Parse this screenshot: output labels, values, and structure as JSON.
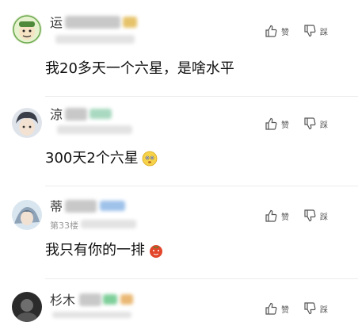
{
  "actions": {
    "like_label": "赞",
    "dislike_label": "踩"
  },
  "comments": [
    {
      "name_visible": "运",
      "floor": "",
      "text": "我20多天一个六星，是啥水平",
      "emoji": ""
    },
    {
      "name_visible": "涼",
      "floor": "",
      "text": "300天2个六星",
      "emoji": "flushed-face"
    },
    {
      "name_visible": "蒂",
      "floor": "第33楼",
      "text": "我只有你的一排",
      "emoji": "tomato"
    },
    {
      "name_visible": "杉木",
      "floor": "",
      "text": "",
      "emoji": ""
    }
  ],
  "colors": {
    "accent_blue": "#4a90d9",
    "accent_green": "#4bbf8c",
    "skin": "#f0d9b5"
  }
}
